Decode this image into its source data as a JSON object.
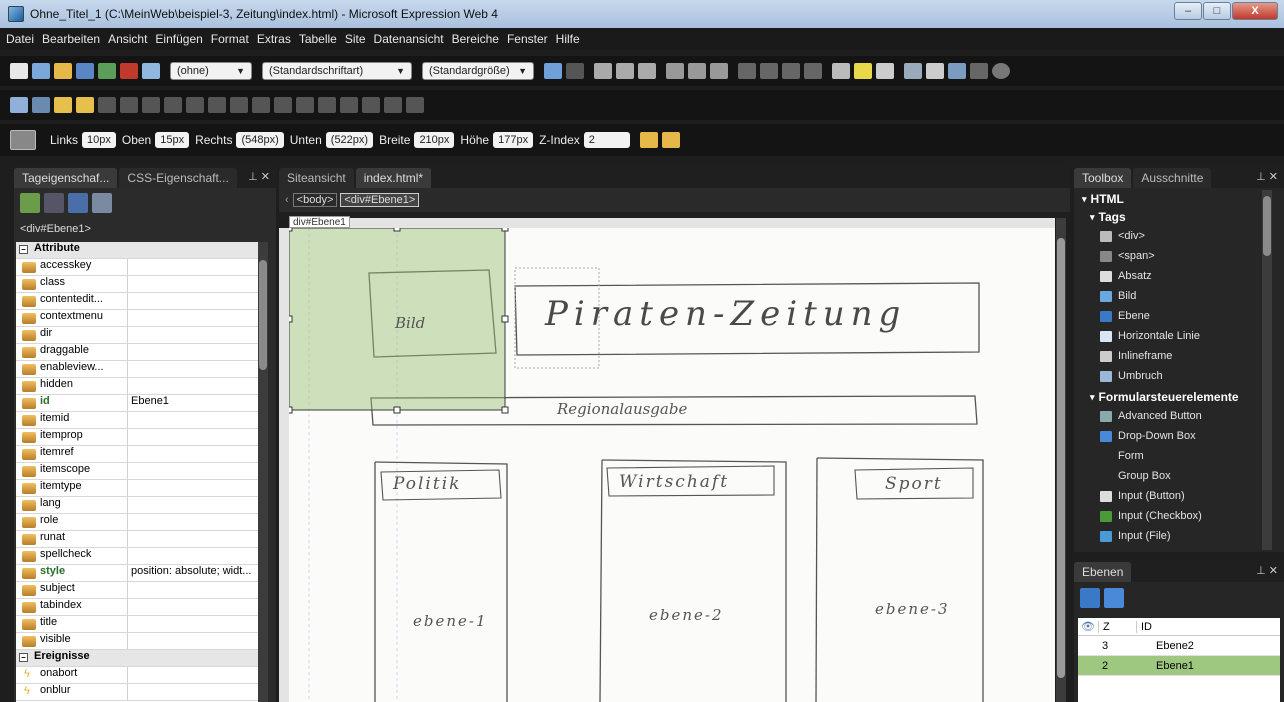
{
  "window": {
    "title": "Ohne_Titel_1 (C:\\MeinWeb\\beispiel-3, Zeitung\\index.html) - Microsoft Expression Web 4",
    "min": "–",
    "max": "□",
    "close": "X"
  },
  "menu": [
    "Datei",
    "Bearbeiten",
    "Ansicht",
    "Einfügen",
    "Format",
    "Extras",
    "Tabelle",
    "Site",
    "Datenansicht",
    "Bereiche",
    "Fenster",
    "Hilfe"
  ],
  "toolbar": {
    "style_select": "(ohne)",
    "font_select": "(Standardschriftart)",
    "size_select": "(Standardgröße)"
  },
  "position_bar": {
    "links_label": "Links",
    "links_value": "10px",
    "oben_label": "Oben",
    "oben_value": "15px",
    "rechts_label": "Rechts",
    "rechts_value": "(548px)",
    "unten_label": "Unten",
    "unten_value": "(522px)",
    "breite_label": "Breite",
    "breite_value": "210px",
    "hoehe_label": "Höhe",
    "hoehe_value": "177px",
    "zindex_label": "Z-Index",
    "zindex_value": "2"
  },
  "left_panel": {
    "tab1": "Tageigenschaf...",
    "tab2": "CSS-Eigenschaft...",
    "selected_tag": "<div#Ebene1>",
    "category_attr": "Attribute",
    "attributes": [
      {
        "k": "accesskey",
        "v": ""
      },
      {
        "k": "class",
        "v": ""
      },
      {
        "k": "contentedit...",
        "v": ""
      },
      {
        "k": "contextmenu",
        "v": ""
      },
      {
        "k": "dir",
        "v": ""
      },
      {
        "k": "draggable",
        "v": ""
      },
      {
        "k": "enableview...",
        "v": ""
      },
      {
        "k": "hidden",
        "v": ""
      },
      {
        "k": "id",
        "v": "Ebene1",
        "bold": true
      },
      {
        "k": "itemid",
        "v": ""
      },
      {
        "k": "itemprop",
        "v": ""
      },
      {
        "k": "itemref",
        "v": ""
      },
      {
        "k": "itemscope",
        "v": ""
      },
      {
        "k": "itemtype",
        "v": ""
      },
      {
        "k": "lang",
        "v": ""
      },
      {
        "k": "role",
        "v": ""
      },
      {
        "k": "runat",
        "v": ""
      },
      {
        "k": "spellcheck",
        "v": ""
      },
      {
        "k": "style",
        "v": "position: absolute; widt...",
        "bold": true
      },
      {
        "k": "subject",
        "v": ""
      },
      {
        "k": "tabindex",
        "v": ""
      },
      {
        "k": "title",
        "v": ""
      },
      {
        "k": "visible",
        "v": ""
      }
    ],
    "category_events": "Ereignisse",
    "events": [
      "onabort",
      "onblur"
    ]
  },
  "editor": {
    "tab_site": "Siteansicht",
    "tab_file": "index.html*",
    "crumb_body": "<body>",
    "crumb_div": "<div#Ebene1>",
    "layer_label": "div#Ebene1",
    "sketch": {
      "bild": "Bild",
      "title": "Piraten-Zeitung",
      "sub": "Regionalausgabe",
      "col1": "Politik",
      "col2": "Wirtschaft",
      "col3": "Sport",
      "e1": "ebene-1",
      "e2": "ebene-2",
      "e3": "ebene-3"
    }
  },
  "toolbox": {
    "tab1": "Toolbox",
    "tab2": "Ausschnitte",
    "html": "HTML",
    "tags": "Tags",
    "tag_items": [
      "<div>",
      "<span>",
      "Absatz",
      "Bild",
      "Ebene",
      "Horizontale Linie",
      "Inlineframe",
      "Umbruch"
    ],
    "forms": "Formularsteuerelemente",
    "form_items": [
      "Advanced Button",
      "Drop-Down Box",
      "Form",
      "Group Box",
      "Input (Button)",
      "Input (Checkbox)",
      "Input (File)"
    ]
  },
  "layers": {
    "title": "Ebenen",
    "col_z": "Z",
    "col_id": "ID",
    "rows": [
      {
        "z": "3",
        "id": "Ebene2"
      },
      {
        "z": "2",
        "id": "Ebene1"
      }
    ]
  }
}
